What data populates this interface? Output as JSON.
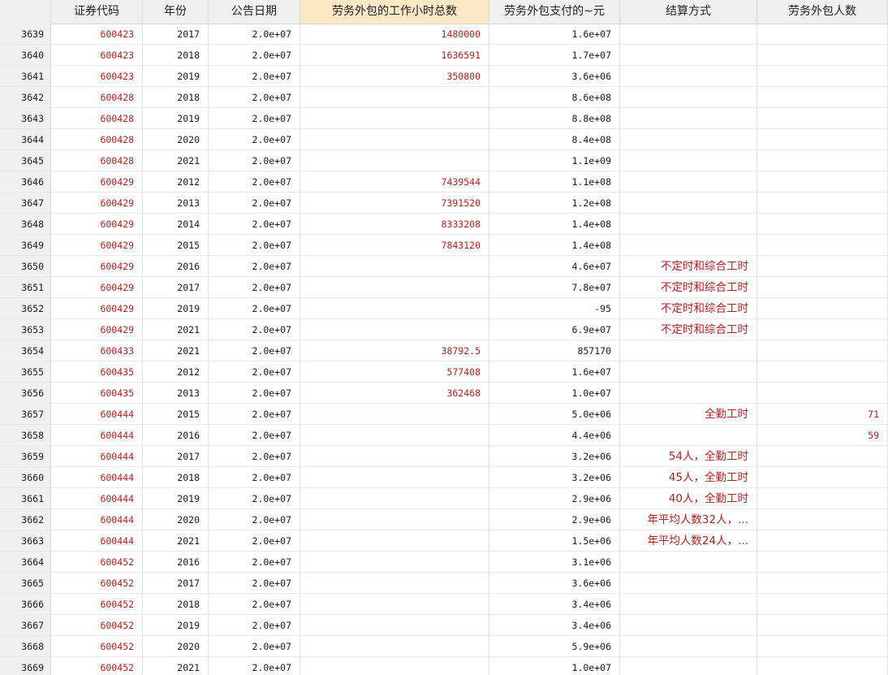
{
  "columns": [
    "",
    "证券代码",
    "年份",
    "公告日期",
    "劳务外包的工作小时总数",
    "劳务外包支付的~元",
    "结算方式",
    "劳务外包人数"
  ],
  "rows": [
    [
      "3639",
      "600423",
      "2017",
      "2.0e+07",
      "1480000",
      "1.6e+07",
      "",
      ""
    ],
    [
      "3640",
      "600423",
      "2018",
      "2.0e+07",
      "1636591",
      "1.7e+07",
      "",
      ""
    ],
    [
      "3641",
      "600423",
      "2019",
      "2.0e+07",
      "350800",
      "3.6e+06",
      "",
      ""
    ],
    [
      "3642",
      "600428",
      "2018",
      "2.0e+07",
      "",
      "8.6e+08",
      "",
      ""
    ],
    [
      "3643",
      "600428",
      "2019",
      "2.0e+07",
      "",
      "8.8e+08",
      "",
      ""
    ],
    [
      "3644",
      "600428",
      "2020",
      "2.0e+07",
      "",
      "8.4e+08",
      "",
      ""
    ],
    [
      "3645",
      "600428",
      "2021",
      "2.0e+07",
      "",
      "1.1e+09",
      "",
      ""
    ],
    [
      "3646",
      "600429",
      "2012",
      "2.0e+07",
      "7439544",
      "1.1e+08",
      "",
      ""
    ],
    [
      "3647",
      "600429",
      "2013",
      "2.0e+07",
      "7391520",
      "1.2e+08",
      "",
      ""
    ],
    [
      "3648",
      "600429",
      "2014",
      "2.0e+07",
      "8333208",
      "1.4e+08",
      "",
      ""
    ],
    [
      "3649",
      "600429",
      "2015",
      "2.0e+07",
      "7843120",
      "1.4e+08",
      "",
      ""
    ],
    [
      "3650",
      "600429",
      "2016",
      "2.0e+07",
      "",
      "4.6e+07",
      "不定时和综合工时",
      ""
    ],
    [
      "3651",
      "600429",
      "2017",
      "2.0e+07",
      "",
      "7.8e+07",
      "不定时和综合工时",
      ""
    ],
    [
      "3652",
      "600429",
      "2019",
      "2.0e+07",
      "",
      "-95",
      "不定时和综合工时",
      ""
    ],
    [
      "3653",
      "600429",
      "2021",
      "2.0e+07",
      "",
      "6.9e+07",
      "不定时和综合工时",
      ""
    ],
    [
      "3654",
      "600433",
      "2021",
      "2.0e+07",
      "38792.5",
      "857170",
      "",
      ""
    ],
    [
      "3655",
      "600435",
      "2012",
      "2.0e+07",
      "577408",
      "1.6e+07",
      "",
      ""
    ],
    [
      "3656",
      "600435",
      "2013",
      "2.0e+07",
      "362468",
      "1.0e+07",
      "",
      ""
    ],
    [
      "3657",
      "600444",
      "2015",
      "2.0e+07",
      "",
      "5.0e+06",
      "全勤工时",
      "71"
    ],
    [
      "3658",
      "600444",
      "2016",
      "2.0e+07",
      "",
      "4.4e+06",
      "",
      "59"
    ],
    [
      "3659",
      "600444",
      "2017",
      "2.0e+07",
      "",
      "3.2e+06",
      "54人，全勤工时",
      ""
    ],
    [
      "3660",
      "600444",
      "2018",
      "2.0e+07",
      "",
      "3.2e+06",
      "45人，全勤工时",
      ""
    ],
    [
      "3661",
      "600444",
      "2019",
      "2.0e+07",
      "",
      "2.9e+06",
      "40人，全勤工时",
      ""
    ],
    [
      "3662",
      "600444",
      "2020",
      "2.0e+07",
      "",
      "2.9e+06",
      "年平均人数32人，...",
      ""
    ],
    [
      "3663",
      "600444",
      "2021",
      "2.0e+07",
      "",
      "1.5e+06",
      "年平均人数24人，...",
      ""
    ],
    [
      "3664",
      "600452",
      "2016",
      "2.0e+07",
      "",
      "3.1e+06",
      "",
      ""
    ],
    [
      "3665",
      "600452",
      "2017",
      "2.0e+07",
      "",
      "3.6e+06",
      "",
      ""
    ],
    [
      "3666",
      "600452",
      "2018",
      "2.0e+07",
      "",
      "3.4e+06",
      "",
      ""
    ],
    [
      "3667",
      "600452",
      "2019",
      "2.0e+07",
      "",
      "3.4e+06",
      "",
      ""
    ],
    [
      "3668",
      "600452",
      "2020",
      "2.0e+07",
      "",
      "5.9e+06",
      "",
      ""
    ],
    [
      "3669",
      "600452",
      "2021",
      "2.0e+07",
      "",
      "1.0e+07",
      "",
      ""
    ]
  ],
  "selected_column": 4,
  "colors": {
    "header_bg": "#f0f0f0",
    "selected_header_bg": "#fce8c4",
    "string_text": "#b02020",
    "numeric_text": "#1a1a1a",
    "grid_line": "#e3e3e3"
  }
}
